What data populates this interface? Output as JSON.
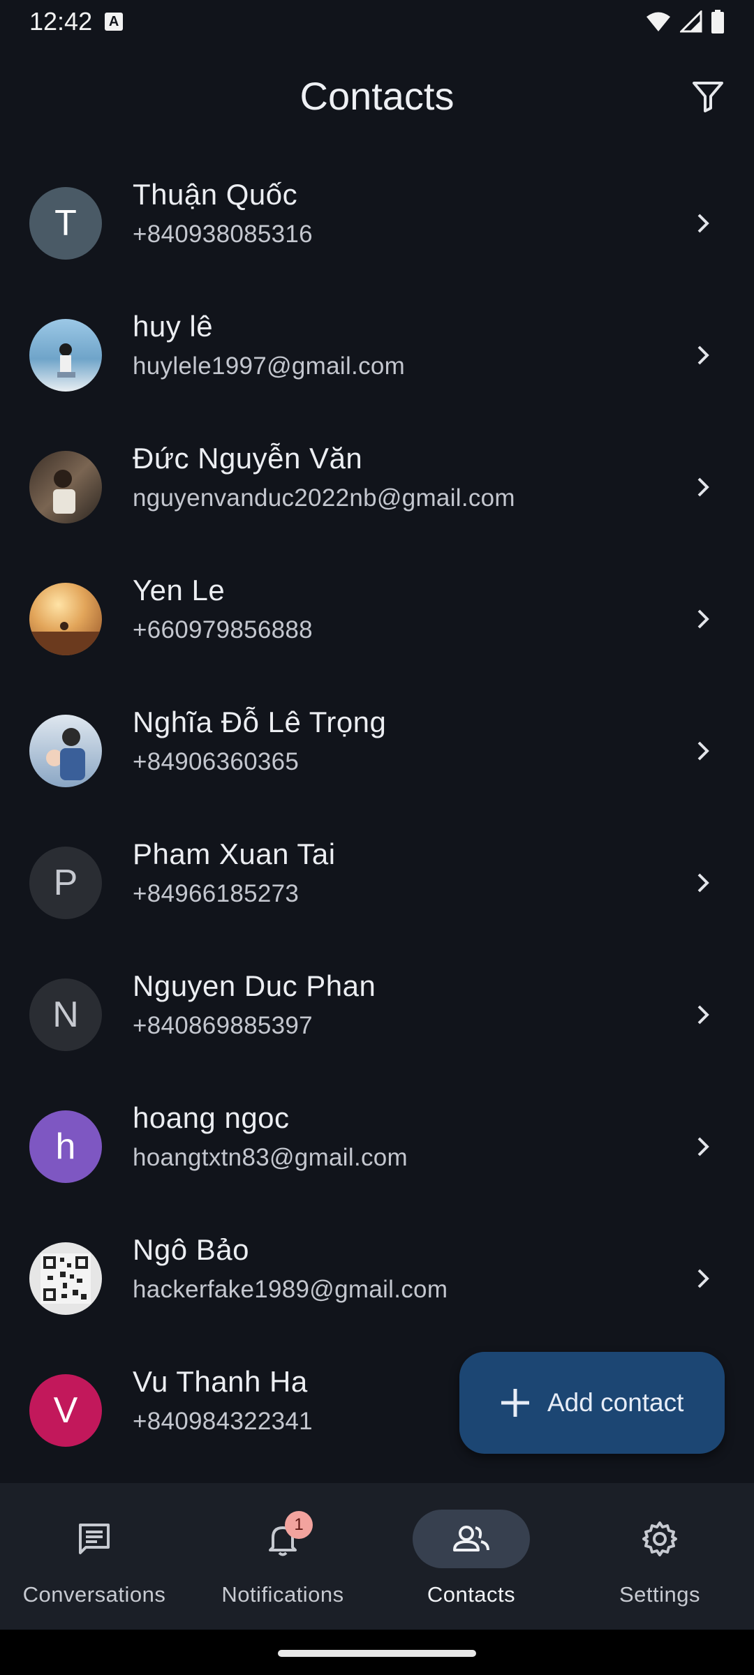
{
  "status_bar": {
    "time": "12:42"
  },
  "header": {
    "title": "Contacts"
  },
  "contacts": [
    {
      "name": "Thuận Quốc",
      "sub": "+840938085316",
      "initial": "T",
      "avatar_color": "#4a5a66"
    },
    {
      "name": "huy lê",
      "sub": "huylele1997@gmail.com",
      "initial": "",
      "avatar_color": "#6fa4c9"
    },
    {
      "name": "Đức Nguyễn Văn",
      "sub": "nguyenvanduc2022nb@gmail.com",
      "initial": "",
      "avatar_color": "#5b4a3c"
    },
    {
      "name": "Yen Le",
      "sub": "+660979856888",
      "initial": "",
      "avatar_color": "#c7843e"
    },
    {
      "name": "Nghĩa Đỗ Lê Trọng",
      "sub": "+84906360365",
      "initial": "",
      "avatar_color": "#8aa6c4"
    },
    {
      "name": "Pham Xuan Tai",
      "sub": "+84966185273",
      "initial": "P",
      "avatar_color": "#2a2d33"
    },
    {
      "name": "Nguyen Duc Phan",
      "sub": "+840869885397",
      "initial": "N",
      "avatar_color": "#2a2d33"
    },
    {
      "name": "hoang ngoc",
      "sub": "hoangtxtn83@gmail.com",
      "initial": "h",
      "avatar_color": "#7e57c2"
    },
    {
      "name": "Ngô Bảo",
      "sub": "hackerfake1989@gmail.com",
      "initial": "",
      "avatar_color": "#d9d9d9"
    },
    {
      "name": "Vu Thanh Ha",
      "sub": "+840984322341",
      "initial": "V",
      "avatar_color": "#c2185b"
    }
  ],
  "fab": {
    "label": "Add contact"
  },
  "nav": {
    "conversations": "Conversations",
    "notifications": "Notifications",
    "notifications_badge": "1",
    "contacts": "Contacts",
    "settings": "Settings"
  },
  "icons": {
    "filter": "filter-icon",
    "chevron": "chevron-right-icon",
    "add": "plus-icon"
  }
}
